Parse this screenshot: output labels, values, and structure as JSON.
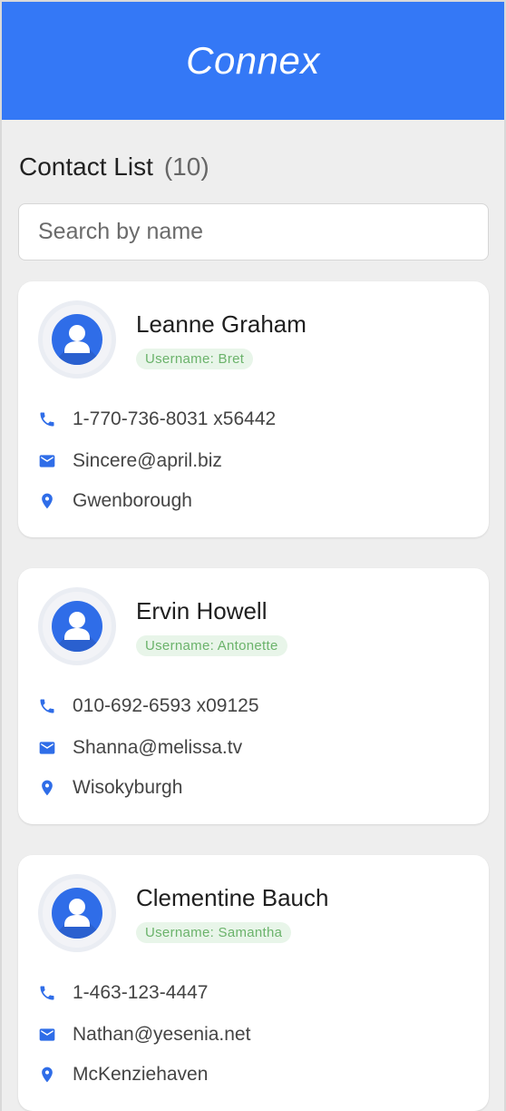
{
  "header": {
    "title": "Connex",
    "background": "#3478f6"
  },
  "contact_list": {
    "title": "Contact List",
    "count_display": "(10)",
    "count": 10
  },
  "search": {
    "placeholder": "Search by name",
    "value": ""
  },
  "contacts": [
    {
      "name": "Leanne Graham",
      "username_label": "Username: Bret",
      "phone": "1-770-736-8031 x56442",
      "email": "Sincere@april.biz",
      "city": "Gwenborough"
    },
    {
      "name": "Ervin Howell",
      "username_label": "Username: Antonette",
      "phone": "010-692-6593 x09125",
      "email": "Shanna@melissa.tv",
      "city": "Wisokyburgh"
    },
    {
      "name": "Clementine Bauch",
      "username_label": "Username: Samantha",
      "phone": "1-463-123-4447",
      "email": "Nathan@yesenia.net",
      "city": "McKenziehaven"
    }
  ],
  "icons": {
    "avatar": "person-avatar-icon",
    "phone": "phone-icon",
    "email": "envelope-icon",
    "location": "location-pin-icon"
  },
  "colors": {
    "accent": "#3478f6",
    "badge_bg": "#e8f5e9",
    "badge_text": "#6bb36b",
    "icon_blue": "#2f6de8"
  }
}
